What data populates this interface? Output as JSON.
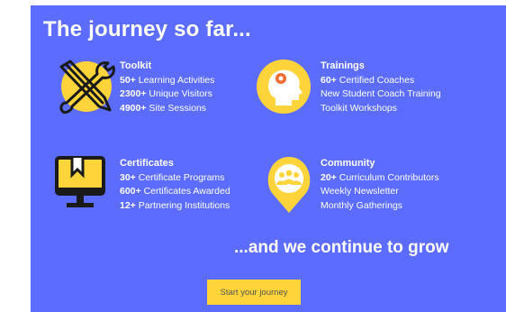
{
  "title": "The journey so far...",
  "colors": {
    "background": "#5b6cff",
    "accent": "#ffd43b",
    "icon_dark": "#1a1a1a"
  },
  "sections": {
    "toolkit": {
      "icon": "tools-icon",
      "heading": "Toolkit",
      "lines": [
        {
          "num": "50+",
          "text": "Learning Activities"
        },
        {
          "num": "2300+",
          "text": "Unique Visitors"
        },
        {
          "num": "4900+",
          "text": "Site Sessions"
        }
      ]
    },
    "trainings": {
      "icon": "head-gear-icon",
      "heading": "Trainings",
      "lines": [
        {
          "num": "60+",
          "text": "Certified Coaches"
        },
        {
          "num": "",
          "text": "New Student Coach Training"
        },
        {
          "num": "",
          "text": "Toolkit Workshops"
        }
      ]
    },
    "certificates": {
      "icon": "monitor-bookmark-icon",
      "heading": "Certificates",
      "lines": [
        {
          "num": "30+",
          "text": "Certificate Programs"
        },
        {
          "num": "600+",
          "text": "Certificates Awarded"
        },
        {
          "num": "12+",
          "text": "Partnering Institutions"
        }
      ]
    },
    "community": {
      "icon": "people-pin-icon",
      "heading": "Community",
      "lines": [
        {
          "num": "20+",
          "text": "Curriculum Contributors"
        },
        {
          "num": "",
          "text": "Weekly Newsletter"
        },
        {
          "num": "",
          "text": "Monthly Gatherings"
        }
      ]
    }
  },
  "tagline": "...and we continue to grow",
  "cta_label": "Start your journey"
}
